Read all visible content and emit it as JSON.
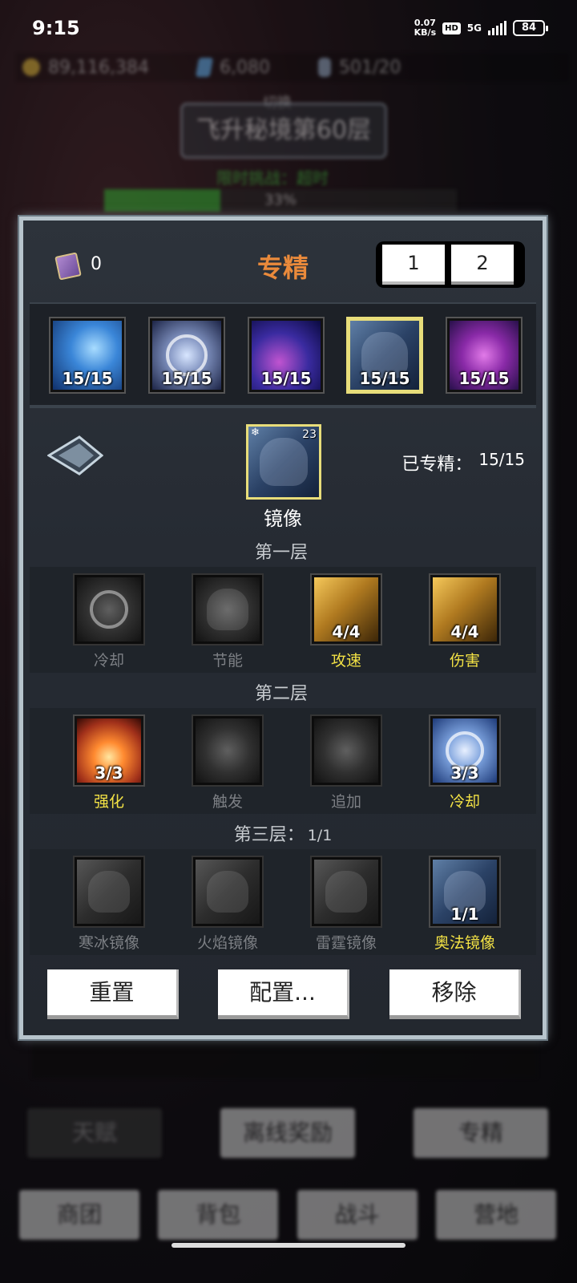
{
  "status_bar": {
    "time": "9:15",
    "net_speed_value": "0.07",
    "net_speed_unit": "KB/s",
    "hd": "HD",
    "network": "5G",
    "battery": "84"
  },
  "hud": {
    "gold": "89,116,384",
    "gems": "6,080",
    "potions": "501/20",
    "stage_switch": "切换",
    "stage_name": "飞升秘境第60层",
    "challenge": "限时挑战：超时",
    "progress_label": "33%",
    "progress_value": 0.33
  },
  "panel": {
    "book_count": "0",
    "title": "专精",
    "presets": [
      "1",
      "2"
    ],
    "specs": [
      {
        "label": "15/15",
        "icon": "ice-shards-icon"
      },
      {
        "label": "15/15",
        "icon": "arcane-circle-icon"
      },
      {
        "label": "15/15",
        "icon": "rune-icon"
      },
      {
        "label": "15/15",
        "icon": "mirror-image-icon",
        "selected": true
      },
      {
        "label": "15/15",
        "icon": "arcane-swirl-icon"
      }
    ],
    "detail": {
      "name": "镜像",
      "badge": "23",
      "mastered_label": "已专精：",
      "mastered_value": "15/15"
    },
    "tiers": [
      {
        "title": "第一层",
        "count": "",
        "nodes": [
          {
            "name": "冷却",
            "value": "",
            "active": false,
            "icon": "clock-icon"
          },
          {
            "name": "节能",
            "value": "",
            "active": false,
            "icon": "helmet-icon"
          },
          {
            "name": "攻速",
            "value": "4/4",
            "active": true,
            "icon": "blades-icon"
          },
          {
            "name": "伤害",
            "value": "4/4",
            "active": true,
            "icon": "dagger-icon"
          }
        ]
      },
      {
        "title": "第二层",
        "count": "",
        "nodes": [
          {
            "name": "强化",
            "value": "3/3",
            "active": true,
            "icon": "fire-hand-icon"
          },
          {
            "name": "触发",
            "value": "",
            "active": false,
            "icon": "trigger-icon"
          },
          {
            "name": "追加",
            "value": "",
            "active": false,
            "icon": "gauntlet-icon"
          },
          {
            "name": "冷却",
            "value": "3/3",
            "active": true,
            "icon": "clock-icon"
          }
        ]
      },
      {
        "title": "第三层：",
        "count": "1/1",
        "nodes": [
          {
            "name": "寒冰镜像",
            "value": "",
            "active": false,
            "icon": "mirror-image-icon"
          },
          {
            "name": "火焰镜像",
            "value": "",
            "active": false,
            "icon": "mirror-image-icon"
          },
          {
            "name": "雷霆镜像",
            "value": "",
            "active": false,
            "icon": "mirror-image-icon"
          },
          {
            "name": "奥法镜像",
            "value": "1/1",
            "active": true,
            "icon": "mirror-image-icon"
          }
        ]
      }
    ],
    "buttons": {
      "reset": "重置",
      "config": "配置...",
      "remove": "移除"
    }
  },
  "bottom_nav": {
    "row1": [
      "天赋",
      "离线奖励",
      "专精"
    ],
    "row2": [
      "商团",
      "背包",
      "战斗",
      "营地"
    ]
  }
}
